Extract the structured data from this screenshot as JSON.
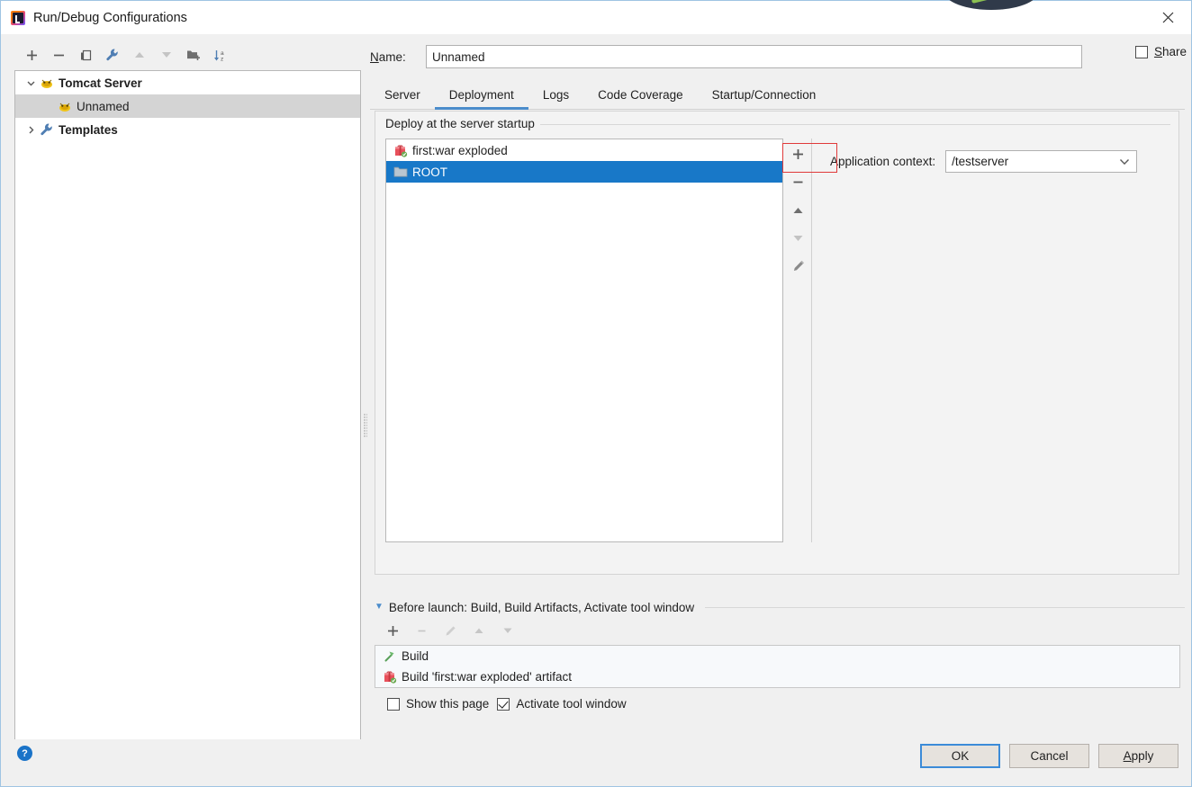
{
  "window": {
    "title": "Run/Debug Configurations",
    "app_icon": "intellij-idea-icon",
    "close_icon": "close-icon"
  },
  "left_toolbar": {
    "buttons": [
      {
        "name": "add-configuration-button",
        "icon": "plus-icon",
        "enabled": true
      },
      {
        "name": "remove-configuration-button",
        "icon": "minus-icon",
        "enabled": true
      },
      {
        "name": "copy-configuration-button",
        "icon": "copy-icon",
        "enabled": true
      },
      {
        "name": "edit-templates-button",
        "icon": "wrench-icon",
        "enabled": true
      },
      {
        "name": "move-up-button",
        "icon": "arrow-up-icon",
        "enabled": false
      },
      {
        "name": "move-down-button",
        "icon": "arrow-down-icon",
        "enabled": false
      },
      {
        "name": "move-into-folder-button",
        "icon": "folder-add-icon",
        "enabled": true
      },
      {
        "name": "sort-alphabetically-button",
        "icon": "sort-az-icon",
        "enabled": true
      }
    ]
  },
  "config_tree": {
    "items": [
      {
        "label": "Tomcat Server",
        "icon": "tomcat-icon",
        "expanded": true,
        "level": 0,
        "selected": false,
        "twisty": "chevron-down"
      },
      {
        "label": "Unnamed",
        "icon": "tomcat-icon",
        "level": 1,
        "selected": true,
        "twisty": ""
      },
      {
        "label": "Templates",
        "icon": "wrench-icon",
        "expanded": false,
        "level": 0,
        "selected": false,
        "twisty": "chevron-right"
      }
    ]
  },
  "name_field": {
    "label": "Name:",
    "label_mnemonic": "N",
    "value": "Unnamed",
    "placeholder": ""
  },
  "share": {
    "label": "Share",
    "label_mnemonic": "S",
    "checked": false
  },
  "tabs": {
    "items": [
      {
        "label": "Server",
        "active": false
      },
      {
        "label": "Deployment",
        "active": true
      },
      {
        "label": "Logs",
        "active": false
      },
      {
        "label": "Code Coverage",
        "active": false
      },
      {
        "label": "Startup/Connection",
        "active": false
      }
    ]
  },
  "deployment": {
    "group_title": "Deploy at the server startup",
    "artifacts": [
      {
        "label": "first:war exploded",
        "icon": "artifact-icon",
        "selected": false
      },
      {
        "label": "ROOT",
        "icon": "folder-icon",
        "selected": true
      }
    ],
    "side_buttons": [
      {
        "name": "add-artifact-button",
        "icon": "plus-icon",
        "enabled": true,
        "highlighted": true
      },
      {
        "name": "remove-artifact-button",
        "icon": "minus-icon",
        "enabled": true,
        "highlighted": false
      },
      {
        "name": "move-artifact-up-button",
        "icon": "arrow-up-icon",
        "enabled": true,
        "highlighted": false
      },
      {
        "name": "move-artifact-down-button",
        "icon": "arrow-down-icon",
        "enabled": false,
        "highlighted": false
      },
      {
        "name": "edit-artifact-button",
        "icon": "pencil-icon",
        "enabled": true,
        "highlighted": false
      }
    ],
    "application_context": {
      "label": "Application context:",
      "value": "/testserver"
    }
  },
  "before_launch": {
    "title": "Before launch: Build, Build Artifacts, Activate tool window",
    "title_mnemonic": "B",
    "toolbar": [
      {
        "name": "add-task-button",
        "icon": "plus-icon",
        "enabled": true
      },
      {
        "name": "remove-task-button",
        "icon": "minus-icon",
        "enabled": false
      },
      {
        "name": "edit-task-button",
        "icon": "pencil-icon",
        "enabled": false
      },
      {
        "name": "task-move-up-button",
        "icon": "arrow-up-icon",
        "enabled": false
      },
      {
        "name": "task-move-down-button",
        "icon": "arrow-down-icon",
        "enabled": false
      }
    ],
    "tasks": [
      {
        "label": "Build",
        "icon": "build-hammer-icon"
      },
      {
        "label": "Build 'first:war exploded' artifact",
        "icon": "artifact-icon"
      }
    ],
    "options": [
      {
        "label": "Show this page",
        "checked": false,
        "name": "show-this-page-checkbox"
      },
      {
        "label": "Activate tool window",
        "checked": true,
        "name": "activate-tool-window-checkbox"
      }
    ]
  },
  "footer": {
    "help_label": "?",
    "ok_label": "OK",
    "cancel_label": "Cancel",
    "apply_label": "Apply",
    "apply_mnemonic": "A"
  },
  "colors": {
    "selection_blue": "#1878c8",
    "tab_underline": "#4b8ccb",
    "highlight_red": "#e03a3a",
    "tree_selection_gray": "#d4d4d4",
    "dialog_bg": "#f0f0f0"
  }
}
